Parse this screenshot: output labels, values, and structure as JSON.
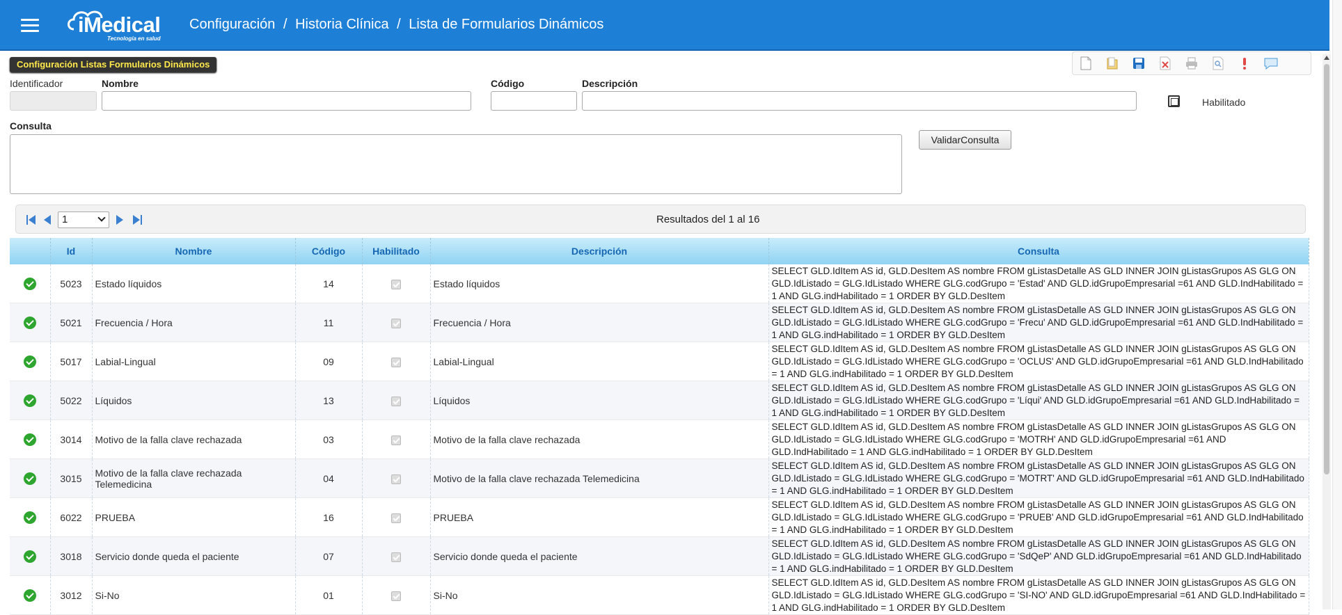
{
  "header": {
    "logo_text": "iMedical",
    "logo_tagline": "Tecnología en salud",
    "breadcrumb": [
      "Configuración",
      "/",
      "Historia Clínica",
      "/",
      "Lista de Formularios Dinámicos"
    ]
  },
  "panel": {
    "title": "Configuración Listas Formularios Dinámicos"
  },
  "toolbar": {
    "icons": [
      "new-document-icon",
      "open-folder-icon",
      "save-icon",
      "delete-icon",
      "print-icon",
      "preview-icon",
      "alert-icon",
      "comment-icon"
    ]
  },
  "form": {
    "identificador_label": "Identificador",
    "nombre_label": "Nombre",
    "codigo_label": "Código",
    "descripcion_label": "Descripción",
    "habilitado_label": "Habilitado",
    "consulta_label": "Consulta",
    "validar_button": "ValidarConsulta"
  },
  "pager": {
    "current_page": "1",
    "results_text": "Resultados del 1 al 16"
  },
  "table": {
    "headers": [
      "",
      "Id",
      "Nombre",
      "Código",
      "Habilitado",
      "Descripción",
      "Consulta"
    ],
    "rows": [
      {
        "id": "5023",
        "nombre": "Estado líquidos",
        "codigo": "14",
        "descripcion": "Estado líquidos",
        "consulta": "SELECT GLD.IdItem AS id, GLD.DesItem AS nombre FROM gListasDetalle AS GLD INNER JOIN gListasGrupos AS GLG ON GLD.IdListado = GLG.IdListado WHERE GLG.codGrupo = 'Estad' AND GLD.idGrupoEmpresarial =61 AND GLD.IndHabilitado = 1 AND GLG.indHabilitado = 1 ORDER BY GLD.DesItem"
      },
      {
        "id": "5021",
        "nombre": "Frecuencia / Hora",
        "codigo": "11",
        "descripcion": "Frecuencia / Hora",
        "consulta": "SELECT GLD.IdItem AS id, GLD.DesItem AS nombre FROM gListasDetalle AS GLD INNER JOIN gListasGrupos AS GLG ON GLD.IdListado = GLG.IdListado WHERE GLG.codGrupo = 'Frecu' AND GLD.idGrupoEmpresarial =61 AND GLD.IndHabilitado = 1 AND GLG.indHabilitado = 1 ORDER BY GLD.DesItem"
      },
      {
        "id": "5017",
        "nombre": "Labial-Lingual",
        "codigo": "09",
        "descripcion": "Labial-Lingual",
        "consulta": "SELECT GLD.IdItem AS id, GLD.DesItem AS nombre FROM gListasDetalle AS GLD INNER JOIN gListasGrupos AS GLG ON GLD.IdListado = GLG.IdListado WHERE GLG.codGrupo = 'OCLUS' AND GLD.idGrupoEmpresarial =61 AND GLD.IndHabilitado = 1 AND GLG.indHabilitado = 1 ORDER BY GLD.DesItem"
      },
      {
        "id": "5022",
        "nombre": "Líquidos",
        "codigo": "13",
        "descripcion": "Líquidos",
        "consulta": "SELECT GLD.IdItem AS id, GLD.DesItem AS nombre FROM gListasDetalle AS GLD INNER JOIN gListasGrupos AS GLG ON GLD.IdListado = GLG.IdListado WHERE GLG.codGrupo = 'Líqui' AND GLD.idGrupoEmpresarial =61 AND GLD.IndHabilitado = 1 AND GLG.indHabilitado = 1 ORDER BY GLD.DesItem"
      },
      {
        "id": "3014",
        "nombre": "Motivo de la falla clave rechazada",
        "codigo": "03",
        "descripcion": "Motivo de la falla clave rechazada",
        "consulta": "SELECT GLD.IdItem AS id, GLD.DesItem AS nombre FROM gListasDetalle AS GLD INNER JOIN gListasGrupos AS GLG ON GLD.IdListado = GLG.IdListado WHERE GLG.codGrupo = 'MOTRH' AND GLD.idGrupoEmpresarial =61 AND GLD.IndHabilitado = 1 AND GLG.indHabilitado = 1 ORDER BY GLD.DesItem"
      },
      {
        "id": "3015",
        "nombre": "Motivo de la falla clave rechazada Telemedicina",
        "codigo": "04",
        "descripcion": "Motivo de la falla clave rechazada Telemedicina",
        "consulta": "SELECT GLD.IdItem AS id, GLD.DesItem AS nombre FROM gListasDetalle AS GLD INNER JOIN gListasGrupos AS GLG ON GLD.IdListado = GLG.IdListado WHERE GLG.codGrupo = 'MOTRT' AND GLD.idGrupoEmpresarial =61 AND GLD.IndHabilitado = 1 AND GLG.indHabilitado = 1 ORDER BY GLD.DesItem"
      },
      {
        "id": "6022",
        "nombre": "PRUEBA",
        "codigo": "16",
        "descripcion": "PRUEBA",
        "consulta": "SELECT GLD.IdItem AS id, GLD.DesItem AS nombre FROM gListasDetalle AS GLD INNER JOIN gListasGrupos AS GLG ON GLD.IdListado = GLG.IdListado WHERE GLG.codGrupo = 'PRUEB' AND GLD.idGrupoEmpresarial =61 AND GLD.IndHabilitado = 1 AND GLG.indHabilitado = 1 ORDER BY GLD.DesItem"
      },
      {
        "id": "3018",
        "nombre": "Servicio donde queda el paciente",
        "codigo": "07",
        "descripcion": "Servicio donde queda el paciente",
        "consulta": "SELECT GLD.IdItem AS id, GLD.DesItem AS nombre FROM gListasDetalle AS GLD INNER JOIN gListasGrupos AS GLG ON GLD.IdListado = GLG.IdListado WHERE GLG.codGrupo = 'SdQeP' AND GLD.idGrupoEmpresarial =61 AND GLD.IndHabilitado = 1 AND GLG.indHabilitado = 1 ORDER BY GLD.DesItem"
      },
      {
        "id": "3012",
        "nombre": "Si-No",
        "codigo": "01",
        "descripcion": "Si-No",
        "consulta": "SELECT GLD.IdItem AS id, GLD.DesItem AS nombre FROM gListasDetalle AS GLD INNER JOIN gListasGrupos AS GLG ON GLD.IdListado = GLG.IdListado WHERE GLG.codGrupo = 'SI-NO' AND GLD.idGrupoEmpresarial =61 AND GLD.IndHabilitado = 1 AND GLG.indHabilitado = 1 ORDER BY GLD.DesItem"
      }
    ]
  }
}
